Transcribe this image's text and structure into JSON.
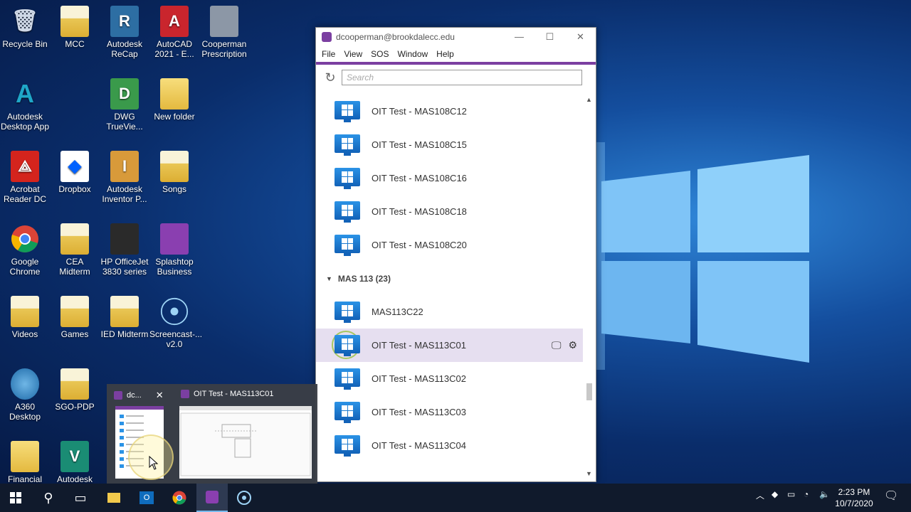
{
  "desktop": {
    "icons": [
      {
        "label": "Recycle Bin"
      },
      {
        "label": "MCC"
      },
      {
        "label": "Autodesk ReCap",
        "glyph": "R"
      },
      {
        "label": "AutoCAD 2021 - E...",
        "glyph": "A"
      },
      {
        "label": "Cooperman Prescription"
      },
      {
        "label": "Autodesk Desktop App",
        "glyph": "A"
      },
      {
        "label": "DWG TrueVie...",
        "glyph": "D"
      },
      {
        "label": "New folder"
      },
      {
        "label": "Acrobat Reader DC"
      },
      {
        "label": "Dropbox"
      },
      {
        "label": "Autodesk Inventor P...",
        "glyph": "I"
      },
      {
        "label": "Songs"
      },
      {
        "label": "Google Chrome"
      },
      {
        "label": "CEA Midterm"
      },
      {
        "label": "HP OfficeJet 3830 series"
      },
      {
        "label": "Splashtop Business"
      },
      {
        "label": "Videos"
      },
      {
        "label": "Games"
      },
      {
        "label": "IED Midterm"
      },
      {
        "label": "Screencast-... v2.0"
      },
      {
        "label": "A360 Desktop"
      },
      {
        "label": "SGO-PDP"
      },
      {
        "label": "Financial Info"
      },
      {
        "label": "Autodesk",
        "glyph": "V"
      }
    ]
  },
  "window": {
    "title": "dcooperman@brookdalecc.edu",
    "menu": [
      "File",
      "View",
      "SOS",
      "Window",
      "Help"
    ],
    "search_placeholder": "Search",
    "rows_before_group": [
      "OIT Test - MAS108C12",
      "OIT Test - MAS108C15",
      "OIT Test - MAS108C16",
      "OIT Test - MAS108C18",
      "OIT Test - MAS108C20"
    ],
    "group_label": "MAS 113 (23)",
    "rows_after_group": [
      "MAS113C22",
      "OIT Test - MAS113C01",
      "OIT Test - MAS113C02",
      "OIT Test - MAS113C03",
      "OIT Test - MAS113C04"
    ],
    "selected_row": "OIT Test - MAS113C01"
  },
  "preview": {
    "tab1": "dc...",
    "tab2": "OIT Test - MAS113C01"
  },
  "taskbar": {
    "time": "2:23 PM",
    "date": "10/7/2020"
  },
  "colors": {
    "accent": "#7b3fa1",
    "selected_row": "#e6dff0"
  }
}
